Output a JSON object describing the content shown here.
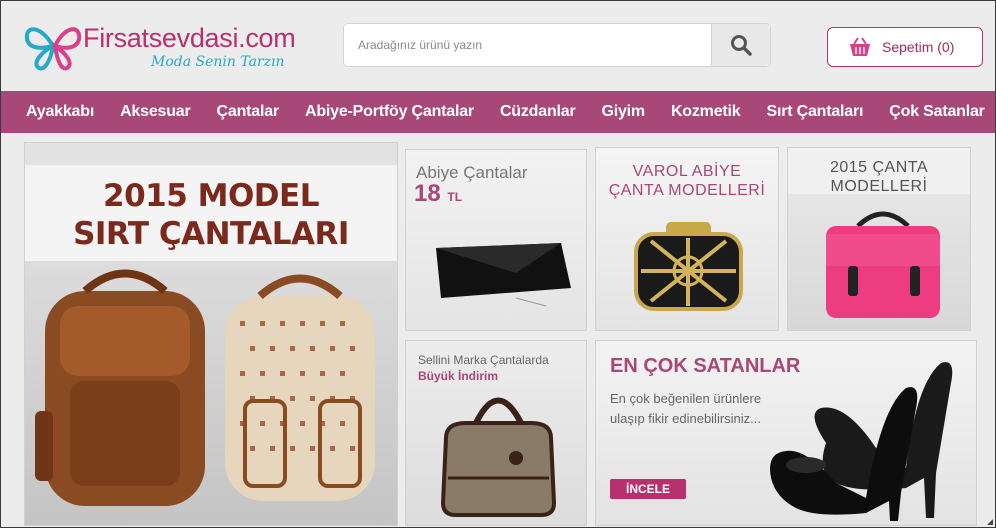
{
  "header": {
    "brand": "Firsatsevdasi.com",
    "tagline": "Moda Senin Tarzın",
    "search_placeholder": "Aradağınız ürünü yazın",
    "cart_label": "Sepetim (0)"
  },
  "nav": {
    "items": [
      "Ayakkabı",
      "Aksesuar",
      "Çantalar",
      "Abiye-Portföy Çantalar",
      "Cüzdanlar",
      "Giyim",
      "Kozmetik",
      "Sırt Çantaları",
      "Çok Satanlar"
    ]
  },
  "banners": {
    "main": {
      "line1": "2015 MODEL",
      "line2": "SIRT ÇANTALARI"
    },
    "abiye": {
      "title": "Abiye Çantalar",
      "price": "18",
      "currency": "TL"
    },
    "varol": {
      "line1": "VAROL ABİYE",
      "line2": "ÇANTA MODELLERİ"
    },
    "canta2015": {
      "line1": "2015 ÇANTA",
      "line2": "MODELLERİ"
    },
    "sellini": {
      "line1": "Sellini Marka Çantalarda",
      "line2": "Büyük İndirim"
    },
    "bestsellers": {
      "title": "EN ÇOK SATANLAR",
      "desc_line1": "En çok beğenilen ürünlere",
      "desc_line2": "ulaşıp fikir edinebilirsiniz...",
      "cta": "İNCELE"
    }
  },
  "colors": {
    "brand": "#b8306e",
    "nav": "#a84878",
    "accent": "#26a9c9"
  },
  "icons": [
    "butterfly-logo-icon",
    "search-icon",
    "basket-icon"
  ]
}
